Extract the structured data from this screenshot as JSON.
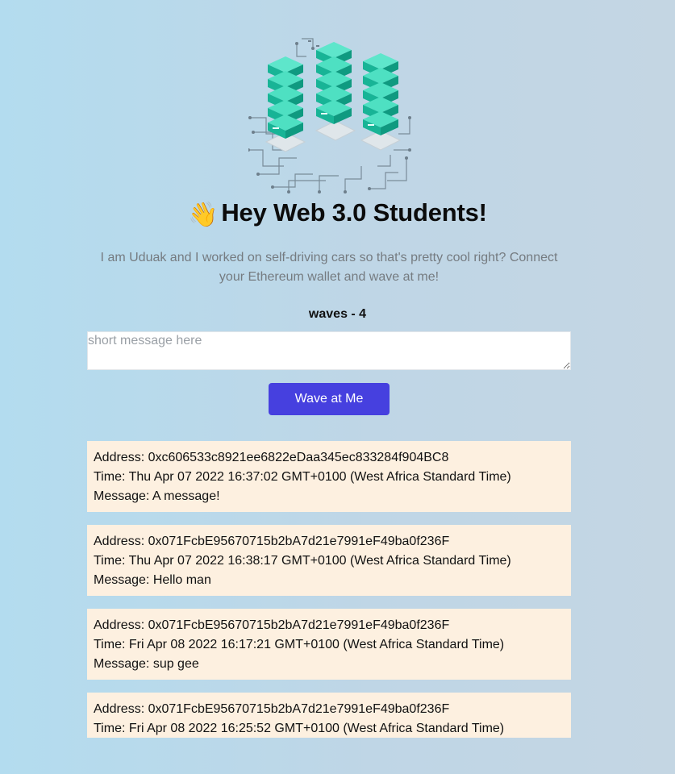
{
  "header": {
    "emoji": "👋",
    "title": "Hey Web 3.0 Students!"
  },
  "bio": "I am Uduak and I worked on self-driving cars so that's pretty cool right? Connect your Ethereum wallet and wave at me!",
  "waves": {
    "count_label": "waves - 4"
  },
  "message_input": {
    "placeholder": "short message here",
    "value": ""
  },
  "wave_button": {
    "label": "Wave at Me"
  },
  "wave_list": [
    {
      "address": "Address: 0xc606533c8921ee6822eDaa345ec833284f904BC8",
      "time": "Time: Thu Apr 07 2022 16:37:02 GMT+0100 (West Africa Standard Time)",
      "message": "Message: A message!"
    },
    {
      "address": "Address: 0x071FcbE95670715b2bA7d21e7991eF49ba0f236F",
      "time": "Time: Thu Apr 07 2022 16:38:17 GMT+0100 (West Africa Standard Time)",
      "message": "Message: Hello man"
    },
    {
      "address": "Address: 0x071FcbE95670715b2bA7d21e7991eF49ba0f236F",
      "time": "Time: Fri Apr 08 2022 16:17:21 GMT+0100 (West Africa Standard Time)",
      "message": "Message: sup gee"
    },
    {
      "address": "Address: 0x071FcbE95670715b2bA7d21e7991eF49ba0f236F",
      "time": "Time: Fri Apr 08 2022 16:25:52 GMT+0100 (West Africa Standard Time)"
    }
  ],
  "colors": {
    "accent": "#4640df",
    "card_background": "#fdf0e0",
    "bio_text": "#757b80",
    "server_teal": "#1fc9a9"
  },
  "icons": {
    "hero": "server-racks-illustration",
    "wave": "waving-hand-emoji"
  }
}
